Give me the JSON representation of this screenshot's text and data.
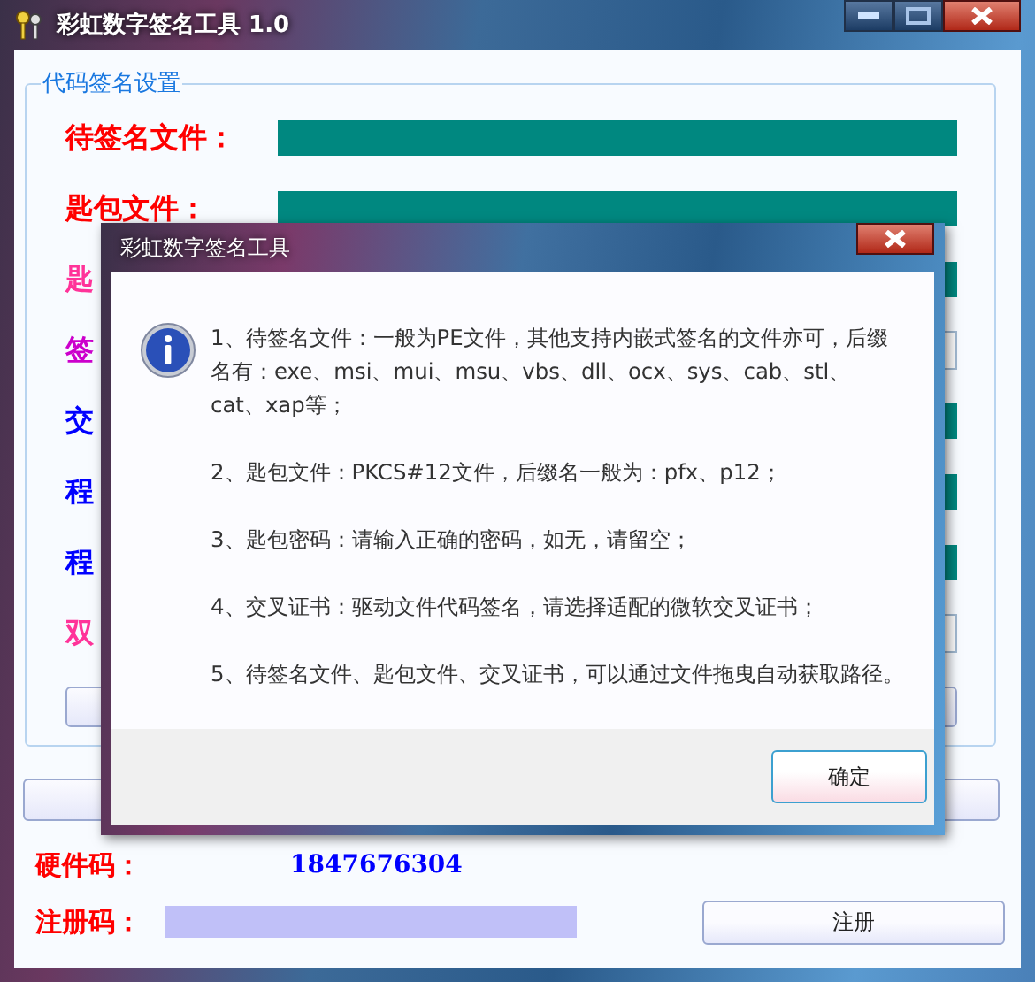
{
  "window": {
    "title": "彩虹数字签名工具 1.0"
  },
  "group": {
    "title": "代码签名设置",
    "rows": [
      {
        "label": "待签名文件：",
        "color": "#ff0000",
        "kind": "filled"
      },
      {
        "label": "匙包文件：",
        "color": "#ff0000",
        "kind": "filled"
      },
      {
        "label": "匙",
        "color": "#ff3399",
        "kind": "filled"
      },
      {
        "label": "签",
        "color": "#cc00cc",
        "kind": "input"
      },
      {
        "label": "交",
        "color": "#0000ff",
        "kind": "filled"
      },
      {
        "label": "程",
        "color": "#0000ff",
        "kind": "filled"
      },
      {
        "label": "程",
        "color": "#0000ff",
        "kind": "filled"
      },
      {
        "label": "双",
        "color": "#ff3399",
        "kind": "input"
      }
    ]
  },
  "hardware": {
    "label": "硬件码：",
    "value": "1847676304"
  },
  "register": {
    "label": "注册码：",
    "button": "注册"
  },
  "dialog": {
    "title": "彩虹数字签名工具",
    "paragraphs": [
      "1、待签名文件：一般为PE文件，其他支持内嵌式签名的文件亦可，后缀名有：exe、msi、mui、msu、vbs、dll、ocx、sys、cab、stl、cat、xap等；",
      "2、匙包文件：PKCS#12文件，后缀名一般为：pfx、p12；",
      "3、匙包密码：请输入正确的密码，如无，请留空；",
      "4、交叉证书：驱动文件代码签名，请选择适配的微软交叉证书；",
      "5、待签名文件、匙包文件、交叉证书，可以通过文件拖曳自动获取路径。"
    ],
    "button": "确定"
  }
}
